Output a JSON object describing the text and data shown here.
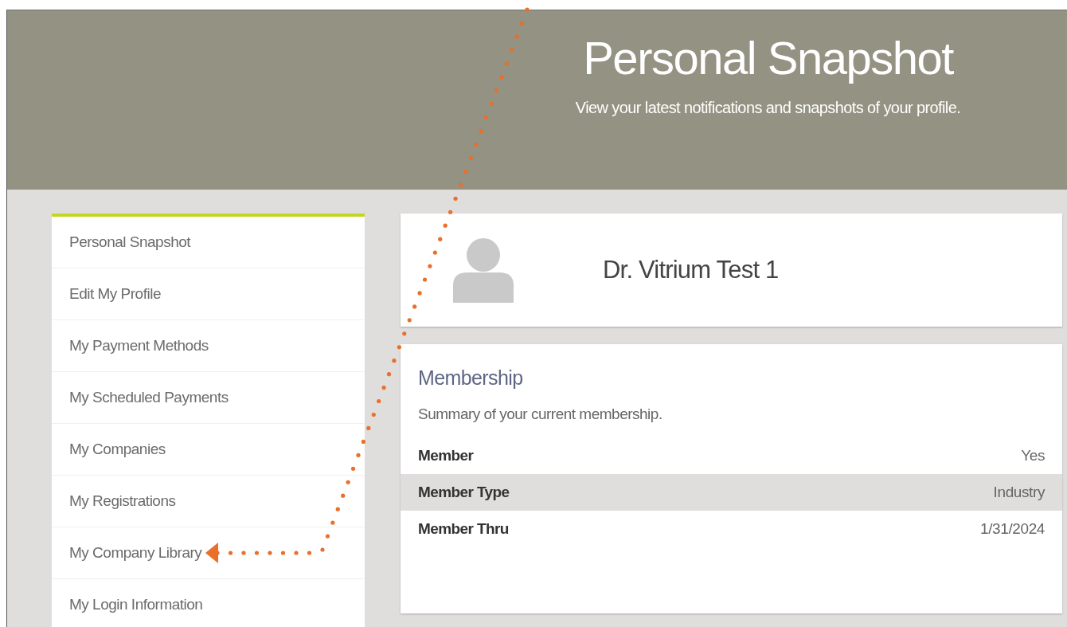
{
  "header": {
    "title": "Personal Snapshot",
    "subtitle": "View your latest notifications and snapshots of your profile."
  },
  "sidebar": {
    "items": [
      {
        "label": "Personal Snapshot",
        "pointed_at": false
      },
      {
        "label": "Edit My Profile",
        "pointed_at": false
      },
      {
        "label": "My Payment Methods",
        "pointed_at": false
      },
      {
        "label": "My Scheduled Payments",
        "pointed_at": false
      },
      {
        "label": "My Companies",
        "pointed_at": false
      },
      {
        "label": "My Registrations",
        "pointed_at": false
      },
      {
        "label": "My Company Library",
        "pointed_at": true
      },
      {
        "label": "My Login Information",
        "pointed_at": false
      }
    ]
  },
  "profile": {
    "name": "Dr. Vitrium Test 1"
  },
  "membership": {
    "title": "Membership",
    "description": "Summary of your current membership.",
    "rows": [
      {
        "label": "Member",
        "value": "Yes",
        "shaded": false
      },
      {
        "label": "Member Type",
        "value": "Industry",
        "shaded": true
      },
      {
        "label": "Member Thru",
        "value": "1/31/2024",
        "shaded": false
      }
    ]
  }
}
